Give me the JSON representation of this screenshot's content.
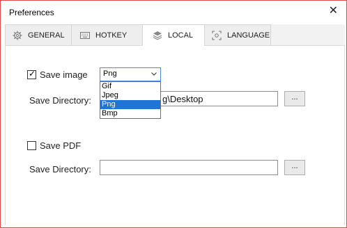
{
  "window": {
    "title": "Preferences"
  },
  "tabs": [
    {
      "label": "GENERAL",
      "icon": "gear-icon",
      "active": false
    },
    {
      "label": "HOTKEY",
      "icon": "keyboard-icon",
      "active": false
    },
    {
      "label": "LOCAL",
      "icon": "layers-icon",
      "active": true
    },
    {
      "label": "LANGUAGE",
      "icon": "language-icon",
      "active": false
    }
  ],
  "local": {
    "save_image": {
      "label": "Save image",
      "checked": true,
      "format_selected": "Png",
      "format_options": [
        "Gif",
        "Jpeg",
        "Png",
        "Bmp"
      ],
      "directory_label": "Save Directory:",
      "directory_value": "g\\Desktop",
      "browse_label": "..."
    },
    "save_pdf": {
      "label": "Save PDF",
      "checked": false,
      "directory_label": "Save Directory:",
      "directory_value": "",
      "browse_label": "..."
    }
  },
  "colors": {
    "accent": "#1e75d6",
    "window_border": "#e04848"
  }
}
